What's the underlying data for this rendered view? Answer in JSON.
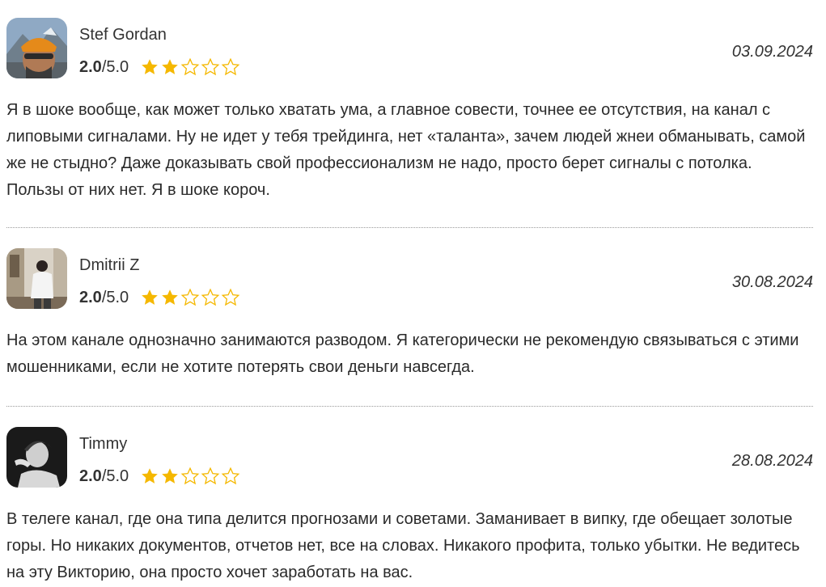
{
  "reviews": [
    {
      "author": "Stef Gordan",
      "score": "2.0",
      "max": "/5.0",
      "stars_filled": 2,
      "stars_total": 5,
      "date": "03.09.2024",
      "text": "Я в шоке вообще, как может только хватать ума, а главное совести, точнее ее отсутствия, на канал с липовыми сигналами. Ну не идет у тебя трейдинга, нет «таланта», зачем людей жнеи обманывать, самой же не стыдно? Даже доказывать свой профессионализм не надо, просто берет сигналы с потолка. Пользы от них нет. Я в шоке короч."
    },
    {
      "author": "Dmitrii Z",
      "score": "2.0",
      "max": "/5.0",
      "stars_filled": 2,
      "stars_total": 5,
      "date": "30.08.2024",
      "text": "На этом канале однозначно занимаются разводом. Я категорически не рекомендую связываться с этими мошенниками, если не хотите потерять свои деньги навсегда."
    },
    {
      "author": "Timmy",
      "score": "2.0",
      "max": "/5.0",
      "stars_filled": 2,
      "stars_total": 5,
      "date": "28.08.2024",
      "text": "В телеге канал, где она типа делится прогнозами и советами. Заманивает в випку, где обещает золотые горы. Но никаких документов, отчетов нет, все на словах. Никакого профита, только убытки. Не ведитесь на эту Викторию, она просто хочет заработать на вас."
    }
  ],
  "colors": {
    "star_filled": "#f5b800",
    "star_empty_stroke": "#f5b800"
  },
  "icons": {
    "star_filled": "star-filled-icon",
    "star_empty": "star-empty-icon"
  }
}
